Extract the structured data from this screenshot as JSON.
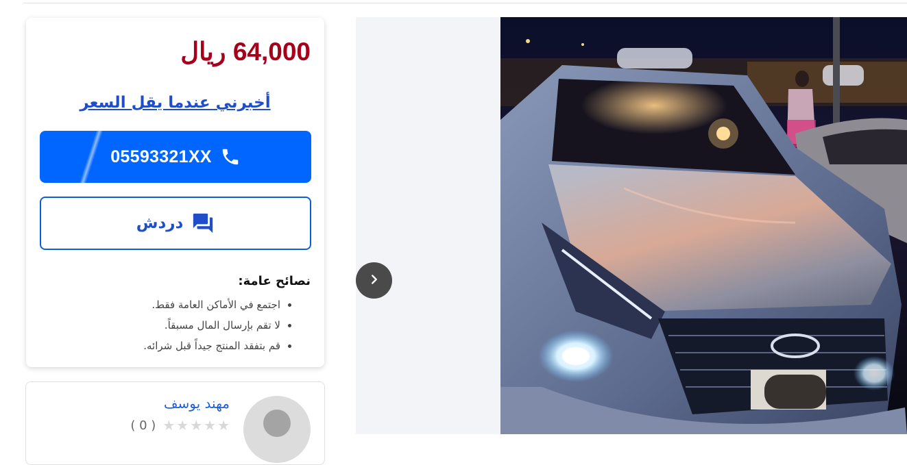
{
  "listing": {
    "price": "64,000 ريال",
    "notify_link": "أخبرني عندما يقل السعر",
    "phone": "05593321XX",
    "chat_label": "دردش",
    "tips_title": "نصائح عامة:",
    "tips": [
      "اجتمع في الأماكن العامة فقط.",
      "لا تقم بإرسال المال مسبقاً.",
      "قم بتفقد المنتج جيداً قبل شرائه."
    ]
  },
  "seller": {
    "name": "مهند يوسف",
    "rating_stars": 0,
    "rating_max": 5,
    "rating_count": "( 0 )"
  },
  "icons": {
    "phone": "phone-icon",
    "chat": "chat-bubbles-icon",
    "gallery_arrow": "chevron-right-icon",
    "star": "star-icon",
    "avatar": "user-avatar-icon"
  },
  "colors": {
    "price": "#a6001b",
    "primary": "#0066ff",
    "link": "#1f4ec8",
    "gallery_bg": "#f3f4f7"
  }
}
